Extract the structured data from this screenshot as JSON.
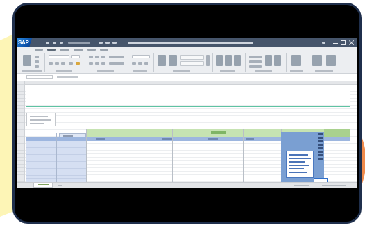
{
  "app": {
    "logo_text": "SAP"
  },
  "colors": {
    "frame_border": "#1f2f4c",
    "titlebar": "#46556b",
    "ribbon": "#eceef1",
    "divider_line": "#5fc3a3",
    "table_header_green": "#c6e3b2",
    "table_header_blue": "#9db6df",
    "key_columns_fill": "#d5dff2",
    "note_panel": "#7a9fd2",
    "selection_border": "#2f6fc9",
    "backdrop_yellow": "#fdf5b6",
    "backdrop_orange": "#f08a4b"
  },
  "icons": {
    "window_controls": [
      "minimize-icon",
      "restore-icon",
      "close-icon"
    ],
    "ribbon": [
      "paste-icon",
      "clipboard-icon",
      "font-icon",
      "alignment-icon",
      "number-format-icon",
      "styles-icon",
      "cells-icon",
      "editing-icon"
    ]
  }
}
